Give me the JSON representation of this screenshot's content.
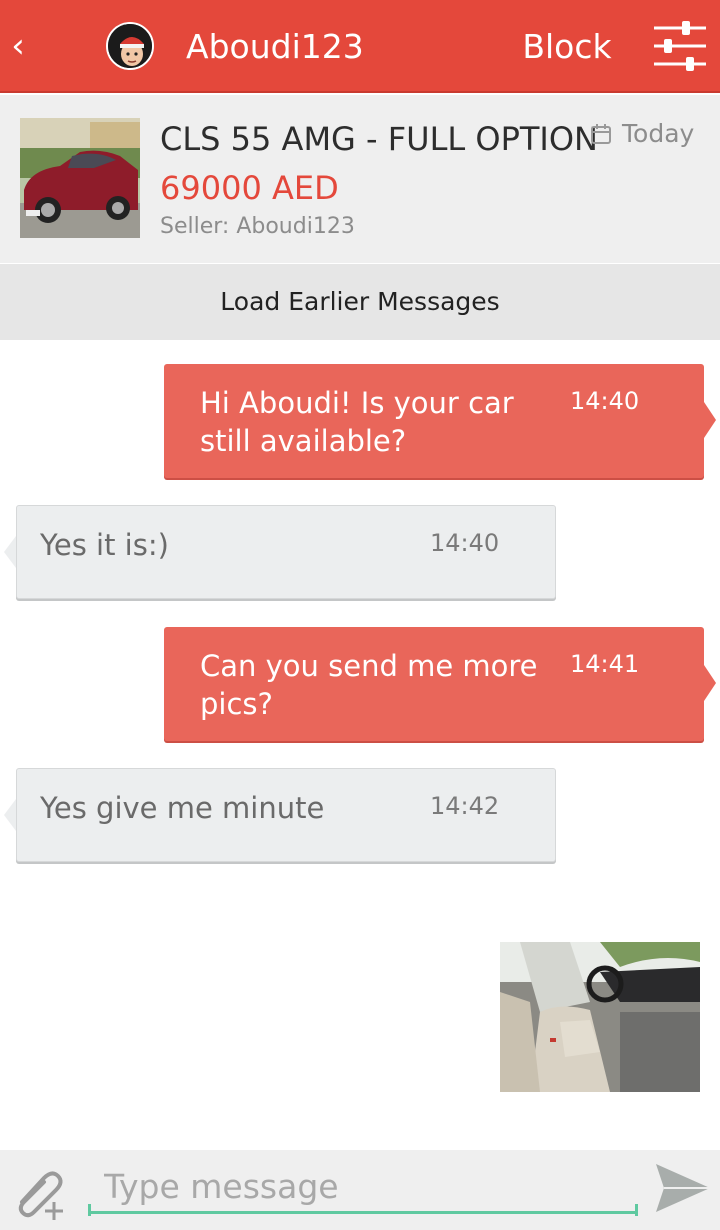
{
  "header": {
    "back_icon": "chevron-left-icon",
    "username": "Aboudi123",
    "block_label": "Block",
    "filter_icon": "sliders-icon",
    "accent_color": "#e4483b"
  },
  "listing": {
    "title": "CLS 55 AMG - FULL OPTION",
    "price": "69000 AED",
    "seller": "Seller: Aboudi123",
    "date": "Today",
    "date_icon": "calendar-icon"
  },
  "load_earlier_label": "Load Earlier Messages",
  "messages": [
    {
      "direction": "outgoing",
      "text": "Hi Aboudi! Is your car still available?",
      "time": "14:40"
    },
    {
      "direction": "incoming",
      "text": "Yes it is:)",
      "time": "14:40"
    },
    {
      "direction": "outgoing",
      "text": "Can you send me more pics?",
      "time": "14:41"
    },
    {
      "direction": "incoming",
      "text": "Yes give me minute",
      "time": "14:42"
    },
    {
      "direction": "incoming",
      "type": "image",
      "image": "car-interior-photo"
    }
  ],
  "composer": {
    "placeholder": "Type message",
    "value": "",
    "attach_icon": "paperclip-plus-icon",
    "send_icon": "send-icon"
  }
}
